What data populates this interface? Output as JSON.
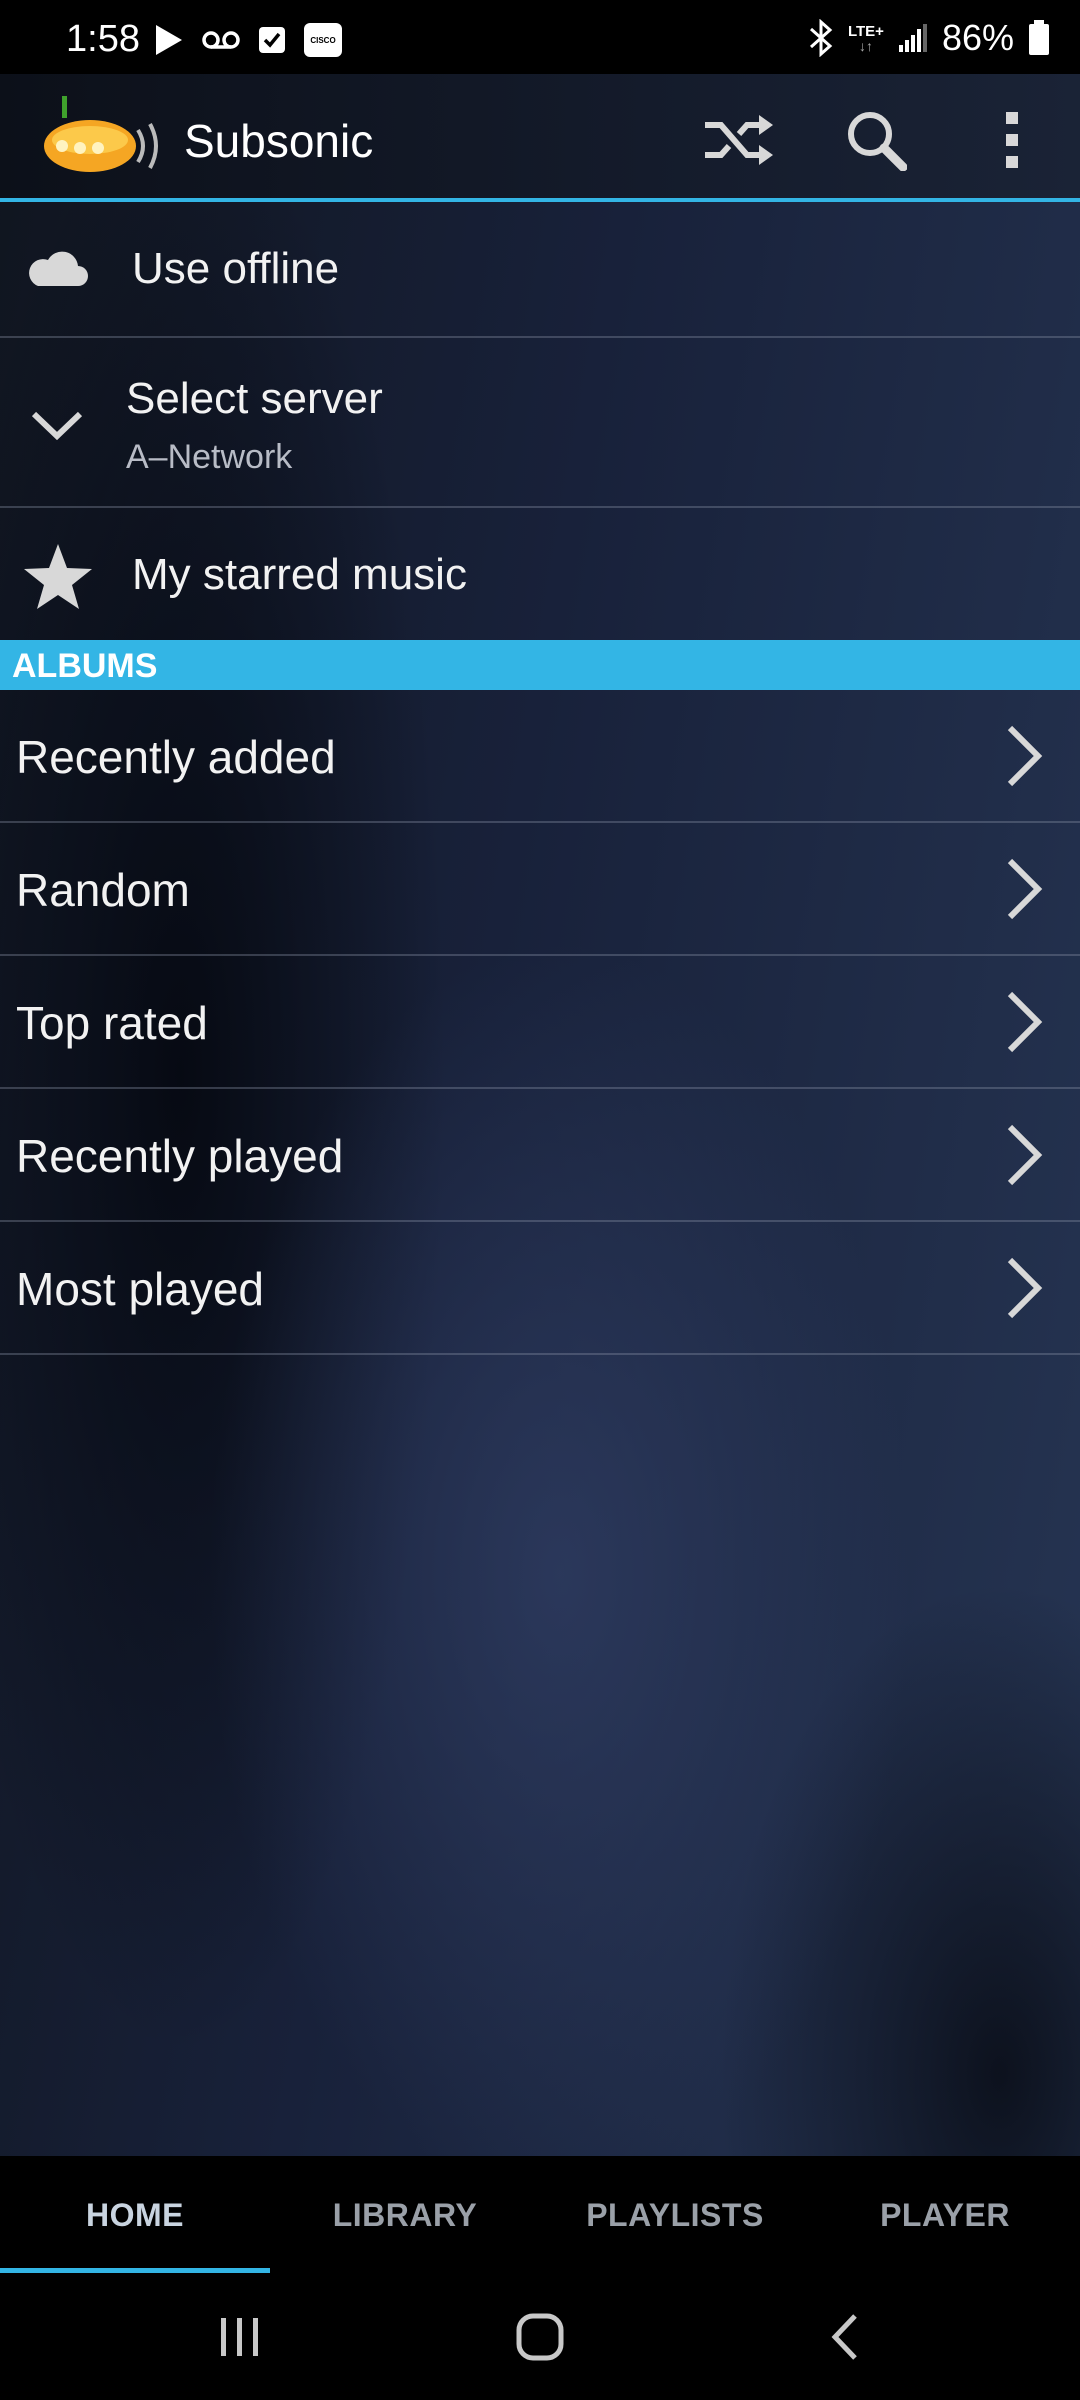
{
  "status_bar": {
    "time": "1:58",
    "network": "LTE+",
    "battery": "86%",
    "left_icons": [
      "play-icon",
      "voicemail-icon",
      "checkbox-icon",
      "cisco-icon"
    ],
    "right_icons": [
      "bluetooth-icon",
      "lte-icon",
      "signal-icon",
      "battery-icon"
    ],
    "cisco_text": "CISCO"
  },
  "app_bar": {
    "title": "Subsonic",
    "actions": [
      "shuffle-icon",
      "search-icon",
      "more-vert-icon"
    ]
  },
  "menu": {
    "use_offline": "Use offline",
    "select_server": "Select server",
    "server_name": "A–Network",
    "starred": "My starred music"
  },
  "albums": {
    "header": "ALBUMS",
    "items": [
      {
        "label": "Recently added"
      },
      {
        "label": "Random"
      },
      {
        "label": "Top rated"
      },
      {
        "label": "Recently played"
      },
      {
        "label": "Most played"
      }
    ]
  },
  "tabs": {
    "items": [
      {
        "label": "HOME"
      },
      {
        "label": "LIBRARY"
      },
      {
        "label": "PLAYLISTS"
      },
      {
        "label": "PLAYER"
      }
    ],
    "active": "HOME"
  },
  "colors": {
    "accent": "#33b5e5",
    "background": "#18213a"
  }
}
